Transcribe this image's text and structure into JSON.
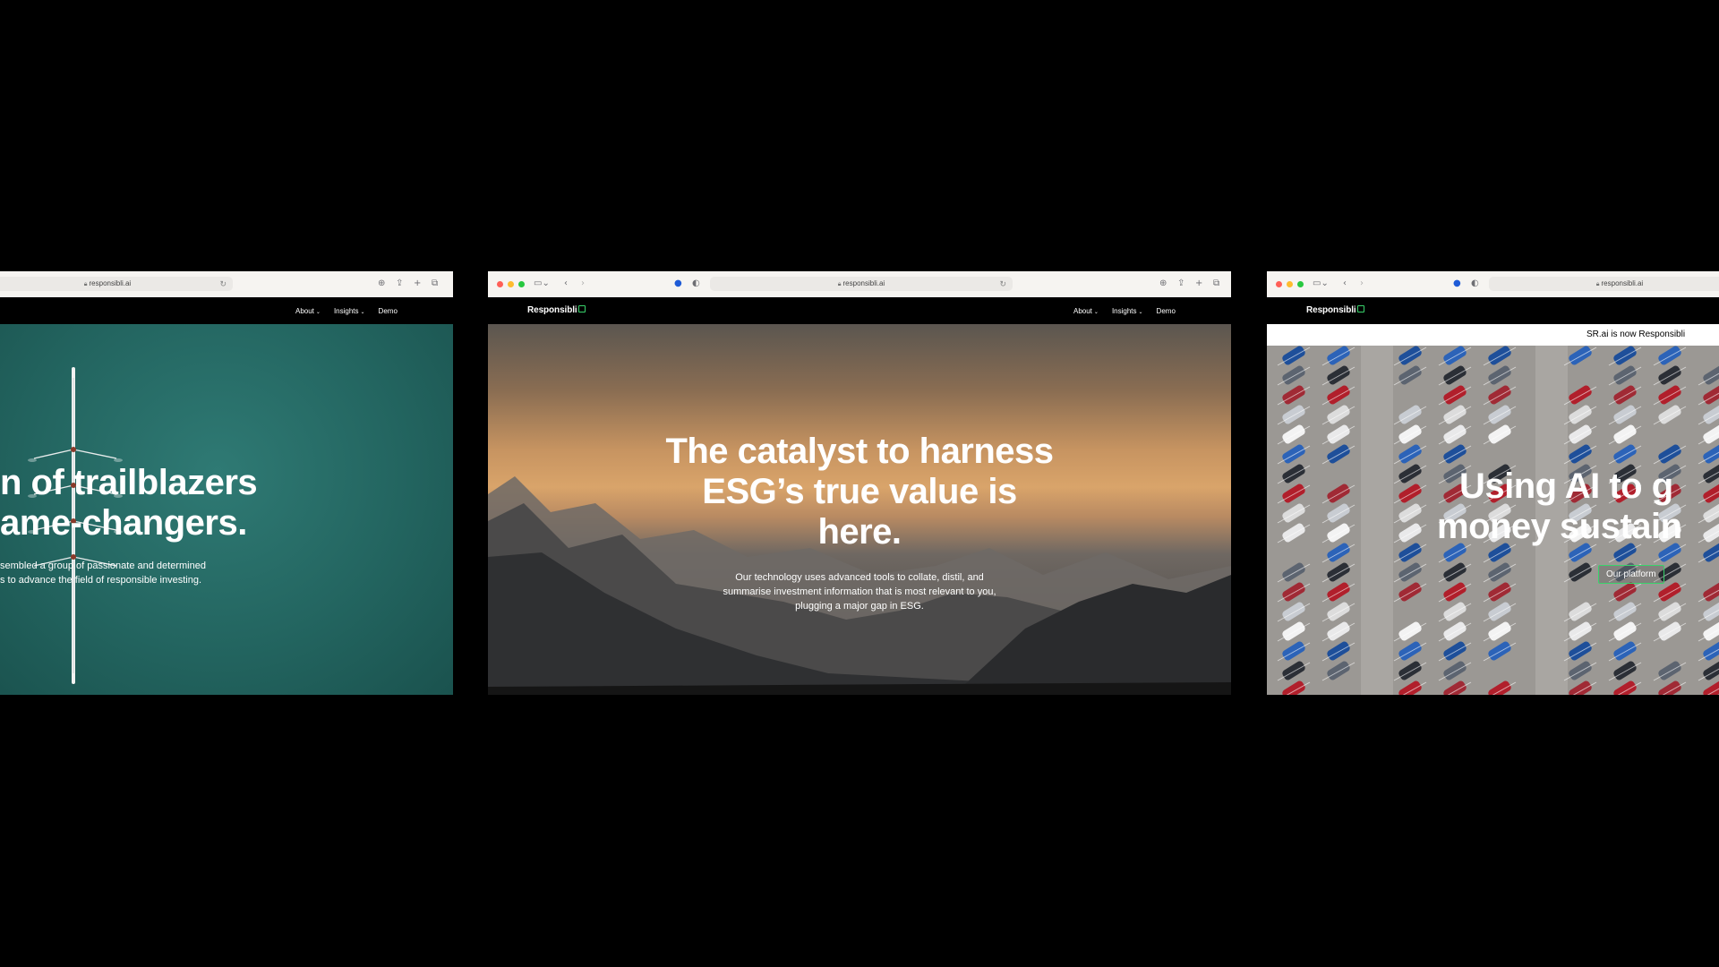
{
  "colors": {
    "background": "#000000",
    "accent_green": "#39d36b",
    "traffic_red": "#ff5f57",
    "traffic_yellow": "#febc2e",
    "traffic_green": "#28c840"
  },
  "left_window": {
    "url": "responsibli.ai",
    "nav": {
      "about": "About",
      "insights": "Insights",
      "demo": "Demo"
    },
    "hero": {
      "title_line1": "n of trailblazers",
      "title_line2": "ame-changers.",
      "sub_line1": "sembled a group of passionate and determined",
      "sub_line2": "s to advance the field of responsible investing."
    }
  },
  "center_window": {
    "url": "responsibli.ai",
    "brand": "Responsibli",
    "nav": {
      "about": "About",
      "insights": "Insights",
      "demo": "Demo"
    },
    "hero": {
      "title_line1": "The catalyst to harness",
      "title_line2": "ESG’s true value is",
      "title_line3": "here.",
      "sub_line1": "Our technology uses advanced tools to collate, distil, and",
      "sub_line2": "summarise investment information that is most relevant to you,",
      "sub_line3": "plugging a major gap in ESG."
    }
  },
  "right_window": {
    "url": "responsibli.ai",
    "brand": "Responsibli",
    "banner": "SR.ai is now Responsibli",
    "hero": {
      "title_line1": "Using AI to g",
      "title_line2": "money sustain",
      "cta": "Our platform"
    }
  },
  "icons": {
    "sidebar": "sidebar-icon",
    "back": "chevron-left-icon",
    "forward": "chevron-right-icon",
    "privacy": "shield-icon",
    "download": "download-icon",
    "share": "share-icon",
    "new_tab": "plus-icon",
    "tabs": "tabs-overview-icon",
    "reload": "reload-icon",
    "lock": "lock-icon"
  }
}
